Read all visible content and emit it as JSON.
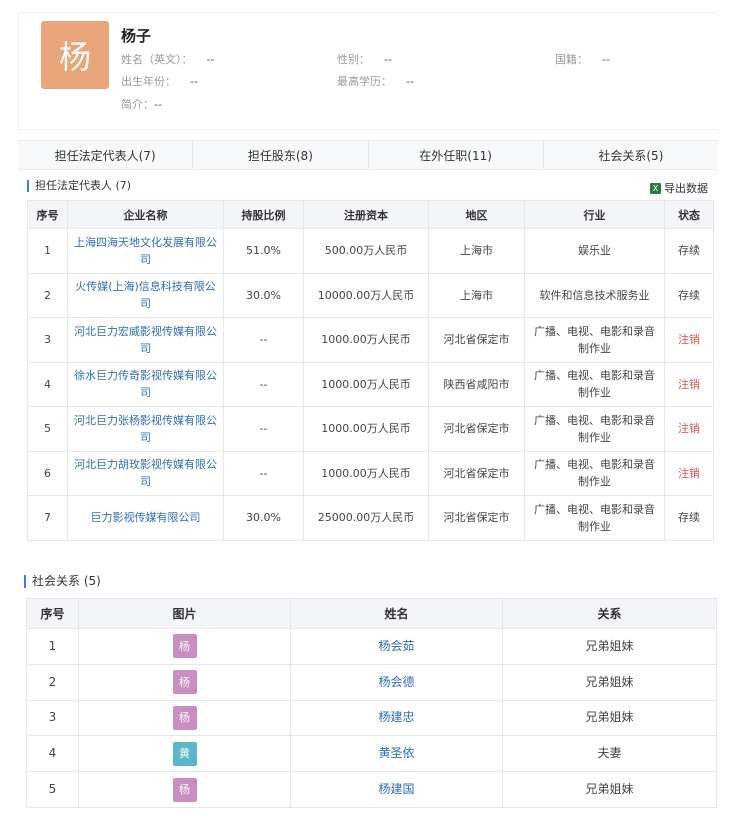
{
  "profile": {
    "avatar_char": "杨",
    "name": "杨子",
    "fields": {
      "english_name_label": "姓名（英文）：",
      "english_name_value": "--",
      "gender_label": "性别：",
      "gender_value": "--",
      "nationality_label": "国籍：",
      "nationality_value": "--",
      "birth_label": "出生年份：",
      "birth_value": "--",
      "education_label": "最高学历：",
      "education_value": "--",
      "bio_label": "简介：",
      "bio_value": "--"
    }
  },
  "tabs": [
    "担任法定代表人(7)",
    "担任股东(8)",
    "在外任职(11)",
    "社会关系(5)"
  ],
  "section1": {
    "title": "担任法定代表人 (7)",
    "export_label": "导出数据",
    "columns": [
      "序号",
      "企业名称",
      "持股比例",
      "注册资本",
      "地区",
      "行业",
      "状态"
    ],
    "rows": [
      [
        "1",
        "上海四海天地文化发展有限公司",
        "51.0%",
        "500.00万人民币",
        "上海市",
        "娱乐业",
        "存续"
      ],
      [
        "2",
        "火传媒(上海)信息科技有限公司",
        "30.0%",
        "10000.00万人民币",
        "上海市",
        "软件和信息技术服务业",
        "存续"
      ],
      [
        "3",
        "河北巨力宏威影视传媒有限公司",
        "--",
        "1000.00万人民币",
        "河北省保定市",
        "广播、电视、电影和录音制作业",
        "注销"
      ],
      [
        "4",
        "徐水巨力传奇影视传媒有限公司",
        "--",
        "1000.00万人民币",
        "陕西省咸阳市",
        "广播、电视、电影和录音制作业",
        "注销"
      ],
      [
        "5",
        "河北巨力张杨影视传媒有限公司",
        "--",
        "1000.00万人民币",
        "河北省保定市",
        "广播、电视、电影和录音制作业",
        "注销"
      ],
      [
        "6",
        "河北巨力胡玫影视传媒有限公司",
        "--",
        "1000.00万人民币",
        "河北省保定市",
        "广播、电视、电影和录音制作业",
        "注销"
      ],
      [
        "7",
        "巨力影视传媒有限公司",
        "30.0%",
        "25000.00万人民币",
        "河北省保定市",
        "广播、电视、电影和录音制作业",
        "存续"
      ]
    ]
  },
  "section2": {
    "title": "社会关系 (5)",
    "columns": [
      "序号",
      "图片",
      "姓名",
      "关系"
    ],
    "rows": [
      {
        "no": "1",
        "avatar": "杨",
        "avatar_color": "#c98fc2",
        "name": "杨会茹",
        "relation": "兄弟姐妹"
      },
      {
        "no": "2",
        "avatar": "杨",
        "avatar_color": "#c98fc2",
        "name": "杨会德",
        "relation": "兄弟姐妹"
      },
      {
        "no": "3",
        "avatar": "杨",
        "avatar_color": "#c98fc2",
        "name": "杨建忠",
        "relation": "兄弟姐妹"
      },
      {
        "no": "4",
        "avatar": "黄",
        "avatar_color": "#5bb7c9",
        "name": "黄圣依",
        "relation": "夫妻"
      },
      {
        "no": "5",
        "avatar": "杨",
        "avatar_color": "#c98fc2",
        "name": "杨建国",
        "relation": "兄弟姐妹"
      }
    ]
  },
  "colors": {
    "accent": "#3b7dd8",
    "link": "#2f6dbb",
    "cancelled": "#d9534f",
    "avatar_main": "#e9a47a"
  }
}
